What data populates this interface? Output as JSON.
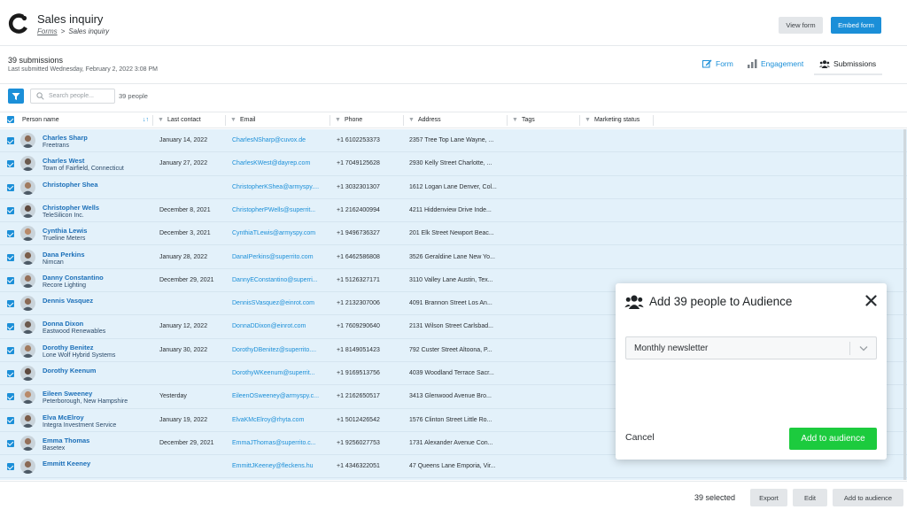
{
  "header": {
    "title": "Sales inquiry",
    "breadcrumb_parent": "Forms",
    "breadcrumb_separator": ">",
    "breadcrumb_current": "Sales inquiry",
    "view_form_label": "View form",
    "embed_form_label": "Embed form"
  },
  "summary": {
    "count_label": "39 submissions",
    "last_submitted": "Last submitted Wednesday, February 2, 2022 3:08 PM"
  },
  "tabs": [
    {
      "label": "Form",
      "icon": "edit-icon"
    },
    {
      "label": "Engagement",
      "icon": "bar-chart-icon"
    },
    {
      "label": "Submissions",
      "icon": "people-icon",
      "active": true
    }
  ],
  "filters": {
    "search_placeholder": "Search people...",
    "people_count": "39 people"
  },
  "table": {
    "columns": [
      "Person name",
      "Last contact",
      "Email",
      "Phone",
      "Address",
      "Tags",
      "Marketing status"
    ],
    "sort_indicator": "↓↑",
    "rows": [
      {
        "name": "Charles Sharp",
        "org": "Freetrans",
        "last_contact": "January 14, 2022",
        "email": "CharlesNSharp@cuvox.de",
        "phone": "+1 6102253373",
        "address": "2357 Tree Top Lane Wayne, ..."
      },
      {
        "name": "Charles West",
        "org": "Town of Fairfield, Connecticut",
        "last_contact": "January 27, 2022",
        "email": "CharlesKWest@dayrep.com",
        "phone": "+1 7049125628",
        "address": "2930 Kelly Street Charlotte, ..."
      },
      {
        "name": "Christopher Shea",
        "org": "",
        "last_contact": "",
        "email": "ChristopherKShea@armyspy....",
        "phone": "+1 3032301307",
        "address": "1612 Logan Lane Denver, Col..."
      },
      {
        "name": "Christopher Wells",
        "org": "TeleSilicon Inc.",
        "last_contact": "December 8, 2021",
        "email": "ChristopherPWells@superrit...",
        "phone": "+1 2162400994",
        "address": "4211 Hiddenview Drive Inde..."
      },
      {
        "name": "Cynthia Lewis",
        "org": "Trueline Meters",
        "last_contact": "December 3, 2021",
        "email": "CynthiaTLewis@armyspy.com",
        "phone": "+1 9496736327",
        "address": "201 Elk Street Newport Beac..."
      },
      {
        "name": "Dana Perkins",
        "org": "Nimcan",
        "last_contact": "January 28, 2022",
        "email": "DanaIPerkins@superrito.com",
        "phone": "+1 6462586808",
        "address": "3526 Geraldine Lane New Yo..."
      },
      {
        "name": "Danny Constantino",
        "org": "Recore Lighting",
        "last_contact": "December 29, 2021",
        "email": "DannyEConstantino@superri...",
        "phone": "+1 5126327171",
        "address": "3110 Valley Lane Austin, Tex..."
      },
      {
        "name": "Dennis Vasquez",
        "org": "",
        "last_contact": "",
        "email": "DennisSVasquez@einrot.com",
        "phone": "+1 2132307006",
        "address": "4091 Brannon Street Los An..."
      },
      {
        "name": "Donna Dixon",
        "org": "Eastwood Renewables",
        "last_contact": "January 12, 2022",
        "email": "DonnaDDixon@einrot.com",
        "phone": "+1 7609290640",
        "address": "2131 Wilson Street Carlsbad..."
      },
      {
        "name": "Dorothy Benitez",
        "org": "Lone Wolf Hybrid Systems",
        "last_contact": "January 30, 2022",
        "email": "DorothyDBenitez@superrito....",
        "phone": "+1 8149051423",
        "address": "792 Custer Street Altoona, P..."
      },
      {
        "name": "Dorothy Keenum",
        "org": "",
        "last_contact": "",
        "email": "DorothyWKeenum@superrit...",
        "phone": "+1 9169513756",
        "address": "4039 Woodland Terrace Sacr..."
      },
      {
        "name": "Eileen Sweeney",
        "org": "Peterborough, New Hampshire",
        "last_contact": "Yesterday",
        "email": "EileenOSweeney@armyspy.c...",
        "phone": "+1 2162650517",
        "address": "3413 Glenwood Avenue Bro..."
      },
      {
        "name": "Elva McElroy",
        "org": "Integra Investment Service",
        "last_contact": "January 19, 2022",
        "email": "ElvaKMcElroy@rhyta.com",
        "phone": "+1 5012426542",
        "address": "1576 Clinton Street Little Ro..."
      },
      {
        "name": "Emma Thomas",
        "org": "Basetex",
        "last_contact": "December 29, 2021",
        "email": "EmmaJThomas@superrito.c...",
        "phone": "+1 9256027753",
        "address": "1731 Alexander Avenue Con..."
      },
      {
        "name": "Emmitt Keeney",
        "org": "",
        "last_contact": "",
        "email": "EmmittJKeeney@fleckens.hu",
        "phone": "+1 4346322051",
        "address": "47 Queens Lane Emporia, Vir..."
      }
    ]
  },
  "footer": {
    "selected_label": "39 selected",
    "export_label": "Export",
    "edit_label": "Edit",
    "add_audience_label": "Add to audience"
  },
  "dialog": {
    "title": "Add 39 people to Audience",
    "close_icon": "close-icon",
    "selected_audience": "Monthly newsletter",
    "cancel_label": "Cancel",
    "confirm_label": "Add to audience"
  },
  "colors": {
    "accent": "#1b8fd8",
    "confirm": "#1ccb3e",
    "row_selected_bg": "#e3f1fa"
  }
}
